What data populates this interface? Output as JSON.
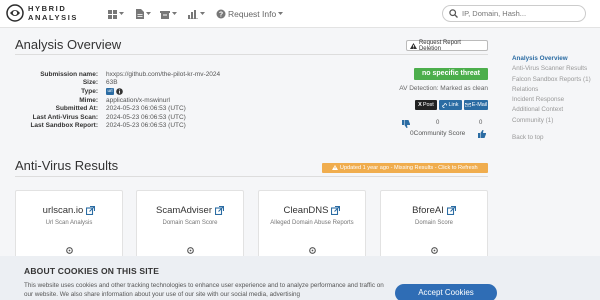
{
  "brand": {
    "line1": "HYBRID",
    "line2": "ANALYSIS"
  },
  "nav": {
    "request_info": "Request Info"
  },
  "search": {
    "placeholder": "IP, Domain, Hash..."
  },
  "overview": {
    "title": "Analysis Overview",
    "request_deletion": "Request Report Deletion",
    "rows": [
      {
        "label": "Submission name:",
        "value": "hxxps://github.com/the-pilot-kr-mv-2024"
      },
      {
        "label": "Size:",
        "value": "63B"
      },
      {
        "label": "Type:",
        "value": ""
      },
      {
        "label": "Mime:",
        "value": "application/x-mswinurl"
      },
      {
        "label": "Submitted At:",
        "value": "2024-05-23 06:06:53 (UTC)"
      },
      {
        "label": "Last Anti-Virus Scan:",
        "value": "2024-05-23 06:06:53 (UTC)"
      },
      {
        "label": "Last Sandbox Report:",
        "value": "2024-05-23 06:06:53 (UTC)"
      }
    ],
    "type_badge": "url",
    "verdict": "no specific threat",
    "av_detection": "AV Detection: Marked as clean",
    "share": {
      "post": "Post",
      "link": "Link",
      "email": "E-Mail"
    },
    "community_score_label": "Community Score",
    "community_score": "0",
    "community_left": "0",
    "community_right": "0"
  },
  "sidebar": {
    "items": [
      "Analysis Overview",
      "Anti-Virus Scanner Results",
      "Falcon Sandbox Reports (1)",
      "Relations",
      "Incident Response",
      "Additional Context",
      "Community (1)"
    ],
    "back_to_top": "Back to top"
  },
  "av_results": {
    "title": "Anti-Virus Results",
    "updated": "Updated 1 year ago - Missing Results - Click to Refresh",
    "cards": [
      {
        "title": "urlscan.io",
        "sub": "Url Scan Analysis"
      },
      {
        "title": "ScamAdviser",
        "sub": "Domain Scam Score"
      },
      {
        "title": "CleanDNS",
        "sub": "Alleged Domain Abuse Reports"
      },
      {
        "title": "BforeAI",
        "sub": "Domain Score"
      }
    ]
  },
  "cookie": {
    "title": "ABOUT COOKIES ON THIS SITE",
    "text": "This website uses cookies and other tracking technologies to enhance user experience and to analyze performance and traffic on our website. We also share information about your use of our site with our social media, advertising",
    "accept": "Accept Cookies"
  },
  "colors": {
    "accent": "#2b6ca3",
    "verdict": "#4cae4c",
    "updated": "#f0ad4e",
    "cookie_button": "#2f6db5"
  }
}
